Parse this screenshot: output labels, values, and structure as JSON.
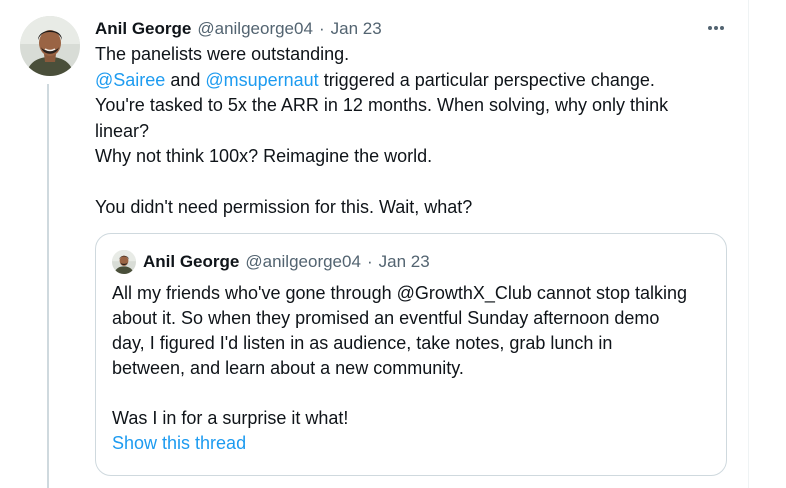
{
  "tweet": {
    "display_name": "Anil George",
    "handle": "@anilgeorge04",
    "separator": "·",
    "date": "Jan 23",
    "line1": "The panelists were outstanding.",
    "mention1": "@Sairee",
    "mid_and": " and ",
    "mention2": "@msupernaut",
    "line2_rest": " triggered a particular perspective change.",
    "line3": "You're tasked to 5x the ARR in 12 months. When solving, why only think",
    "line4": "linear?",
    "line5": "Why not think 100x? Reimagine the world.",
    "line6": "You didn't need permission for this. Wait, what?"
  },
  "quote": {
    "display_name": "Anil George",
    "handle": "@anilgeorge04",
    "separator": "·",
    "date": "Jan 23",
    "lines": [
      "All my friends who've gone through @GrowthX_Club cannot stop talking",
      "about it. So when they promised an eventful Sunday afternoon demo",
      "day, I figured I'd listen in as audience, take notes, grab lunch in",
      "between, and learn about a new community."
    ],
    "closing_line": "Was I in for a surprise it what!",
    "show_thread": "Show this thread"
  },
  "icons": {
    "more": "more-horizontal-icon",
    "avatar": "profile-photo"
  },
  "colors": {
    "link": "#1d9bf0",
    "secondary_text": "#536471",
    "primary_text": "#0f1419",
    "border": "#cfd9de"
  }
}
